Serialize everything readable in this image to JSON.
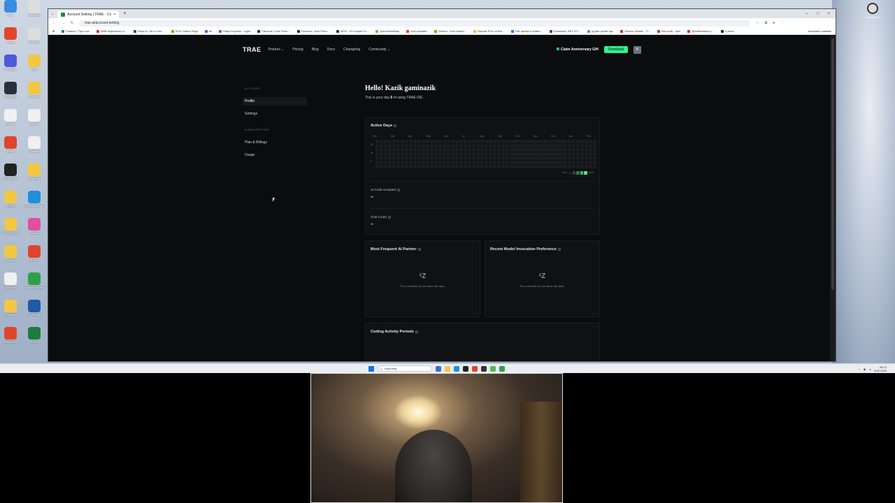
{
  "desktop": {
    "icons": [
      {
        "label": "Kosz",
        "color": "#3a8be0"
      },
      {
        "label": "MANIAK5",
        "color": "#dddddd"
      },
      {
        "label": "Vivaldi",
        "color": "#e0452b"
      },
      {
        "label": "MANIAK",
        "color": "#dddddd"
      },
      {
        "label": "LM Studio",
        "color": "#4d5bd8"
      },
      {
        "label": "Pliki",
        "color": "#f2c744"
      },
      {
        "label": "MusicBee",
        "color": "#2a2f3a"
      },
      {
        "label": "Projekty",
        "color": "#f2c744"
      },
      {
        "label": "Jupyter",
        "color": "#f0f0f0"
      },
      {
        "label": "Skrypt",
        "color": "#f0f0f0"
      },
      {
        "label": "Brave",
        "color": "#e0452b"
      },
      {
        "label": "Notatki",
        "color": "#f0f0f0"
      },
      {
        "label": "OBS Studio",
        "color": "#222222"
      },
      {
        "label": "Nagrania",
        "color": "#f2c744"
      },
      {
        "label": "VIDEOS",
        "color": "#f2c744"
      },
      {
        "label": "Microsoft Edge",
        "color": "#1e90d8"
      },
      {
        "label": "DOKUMENTY",
        "color": "#f2c744"
      },
      {
        "label": "Canva",
        "color": "#e24fa0"
      },
      {
        "label": "Zdjecia",
        "color": "#f2c744"
      },
      {
        "label": "Brave",
        "color": "#e0452b"
      },
      {
        "label": "Dokument",
        "color": "#f0f0f0"
      },
      {
        "label": "Google Chrome",
        "color": "#2fa04a"
      },
      {
        "label": "Projekty2",
        "color": "#f2c744"
      },
      {
        "label": "Aplikacja",
        "color": "#1e5aa8"
      },
      {
        "label": "Brave beta",
        "color": "#e0452b"
      },
      {
        "label": "Excel",
        "color": "#1f7a3d"
      }
    ],
    "right_icon_label": "Ustawienia"
  },
  "browser": {
    "tab_title": "Account Setting | TRAE - Collab...",
    "new_tab": "+",
    "controls": {
      "minimize": "–",
      "maximize": "□",
      "close": "×"
    },
    "url": "trae.ai/account-setting",
    "bookmarks": [
      {
        "label": "Finance | Tips Live",
        "color": "#1e6fd0"
      },
      {
        "label": "DMB Najnowsze pr...",
        "color": "#c0392b"
      },
      {
        "label": "Ninja AI | All In One...",
        "color": "#444444"
      },
      {
        "label": "KICK Status Page",
        "color": "#53c000"
      },
      {
        "label": "all",
        "color": "#7a4fd0"
      },
      {
        "label": "Stripe Express - Login",
        "color": "#635bff"
      },
      {
        "label": "Fanzone | Kick Prem...",
        "color": "#2a2a2a"
      },
      {
        "label": "Fanzone | Kick Prem...",
        "color": "#2a2a2a"
      },
      {
        "label": "MGX - Fix Scripts To...",
        "color": "#333333"
      },
      {
        "label": "OpenStreetMap",
        "color": "#7eb34b"
      },
      {
        "label": "surf-uploader",
        "color": "#e0452b"
      },
      {
        "label": "Stream - Kick Dashb...",
        "color": "#53c000"
      },
      {
        "label": "Deposit PLN on Bin...",
        "color": "#f3ba2f"
      },
      {
        "label": "File upload & sharin...",
        "color": "#2a7ae2"
      },
      {
        "label": "Download .NET 9.0...",
        "color": "#5c2d91"
      },
      {
        "label": "pj plan profile.apc",
        "color": "#888888"
      },
      {
        "label": "Service Details - Tr...",
        "color": "#c0392b"
      },
      {
        "label": "kick-auth - npm",
        "color": "#c0392b"
      },
      {
        "label": "@botkick/kick-p...",
        "color": "#c0392b"
      },
      {
        "label": "X-word",
        "color": "#222222"
      }
    ],
    "bookmarks_folder": "Wszystkie zakładki"
  },
  "nav": {
    "logo": "TRAE",
    "items": [
      "Product ⌄",
      "Pricing",
      "Blog",
      "Docs",
      "Changelog",
      "Community ⌄"
    ],
    "gift": "Claim Anniversary Gift",
    "download": "Download",
    "avatar": "K"
  },
  "sidebar": {
    "account_header": "ACCOUNT",
    "profile": "Profile",
    "settings": "Settings",
    "subscription_header": "SUBSCRIPTION",
    "plan": "Plan & Billings",
    "usage": "Usage"
  },
  "main": {
    "greeting": "Hello! Kazik gaminazik",
    "sub_prefix": "This is your day ",
    "day_count": "0",
    "sub_suffix": " of using TRAE IDE."
  },
  "activity": {
    "title": "Active Days",
    "months": [
      "Feb",
      "Mar",
      "Apr",
      "May",
      "Jun",
      "Jul",
      "Aug",
      "Sep",
      "Oct",
      "Nov",
      "Dec",
      "Jan",
      "Feb"
    ],
    "day_labels": [
      "M",
      "W",
      "F"
    ],
    "legend_less": "Less",
    "legend_more": "More",
    "legend_colors": [
      "#1b1d21",
      "#1f4d32",
      "#2b7a4a",
      "#35b56a",
      "#3ef08a"
    ],
    "ai_code_label": "AI Code Accepted",
    "ai_code_value": "–",
    "chat_label": "Chat Count",
    "chat_value": "–"
  },
  "partner": {
    "title": "Most Frequent AI Partner",
    "empty": "You currently do not have this data."
  },
  "model": {
    "title": "Recent Model Invocation Preference",
    "empty": "You currently do not have this data."
  },
  "coding": {
    "title": "Coding Activity Periods"
  },
  "taskbar": {
    "search": "Wyszukaj",
    "apps": [
      {
        "name": "taskview",
        "color": "#3a6fc0"
      },
      {
        "name": "explorer",
        "color": "#f2c744"
      },
      {
        "name": "edge",
        "color": "#1e90d8"
      },
      {
        "name": "app",
        "color": "#222222"
      },
      {
        "name": "brave",
        "color": "#e0452b"
      },
      {
        "name": "obs",
        "color": "#333333"
      },
      {
        "name": "notepad",
        "color": "#5ab55a"
      },
      {
        "name": "chrome",
        "color": "#2fa04a"
      }
    ],
    "time": "06:13",
    "date": "8.02.2026"
  }
}
